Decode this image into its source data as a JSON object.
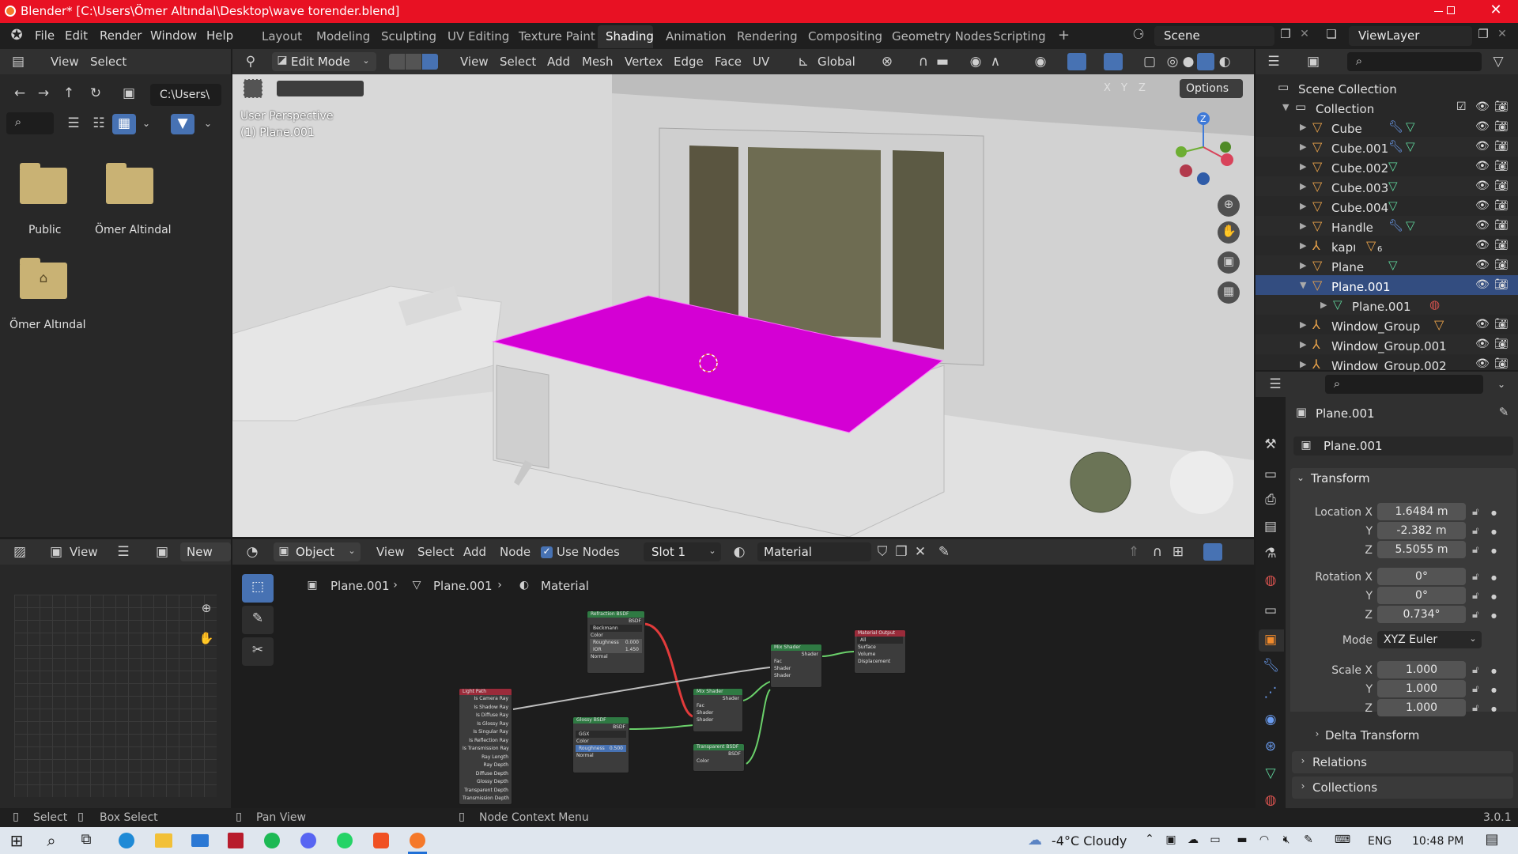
{
  "window": {
    "title": "Blender* [C:\\Users\\Ömer Altındal\\Desktop\\wave torender.blend]"
  },
  "menu": {
    "items": [
      "File",
      "Edit",
      "Render",
      "Window",
      "Help"
    ]
  },
  "workspaces": {
    "tabs": [
      "Layout",
      "Modeling",
      "Sculpting",
      "UV Editing",
      "Texture Paint",
      "Shading",
      "Animation",
      "Rendering",
      "Compositing",
      "Geometry Nodes",
      "Scripting"
    ],
    "active": "Shading",
    "add": "+"
  },
  "scene": {
    "name": "Scene",
    "view_layer": "ViewLayer"
  },
  "file_browser": {
    "menu": [
      "View",
      "Select"
    ],
    "path": "C:\\Users\\",
    "items": [
      {
        "label": "Public",
        "icon": "folder-icon"
      },
      {
        "label": "Ömer Altindal",
        "icon": "folder-icon"
      },
      {
        "label": "Ömer Altındal",
        "icon": "home-folder-icon"
      }
    ]
  },
  "viewport": {
    "mode": "Edit Mode",
    "menu": [
      "View",
      "Select",
      "Add",
      "Mesh",
      "Vertex",
      "Edge",
      "Face",
      "UV"
    ],
    "orientation": "Global",
    "perspective_label": "User Perspective",
    "object_label": "(1) Plane.001",
    "options": "Options",
    "axes": [
      "X",
      "Y",
      "Z"
    ],
    "gizmo_z": "Z",
    "accent_color": "#d400d4"
  },
  "outliner": {
    "root": "Scene Collection",
    "collection": "Collection",
    "items": [
      {
        "name": "Cube",
        "icon": "mesh-object-icon",
        "extra": "wrench-and-mesh"
      },
      {
        "name": "Cube.001",
        "icon": "mesh-object-icon",
        "extra": "wrench-and-mesh"
      },
      {
        "name": "Cube.002",
        "icon": "mesh-object-icon",
        "extra": "mesh"
      },
      {
        "name": "Cube.003",
        "icon": "mesh-object-icon",
        "extra": "mesh"
      },
      {
        "name": "Cube.004",
        "icon": "mesh-object-icon",
        "extra": "mesh"
      },
      {
        "name": "Handle",
        "icon": "mesh-object-icon",
        "extra": "wrench-and-mesh"
      },
      {
        "name": "kapı",
        "icon": "empty-icon",
        "extra": "6"
      },
      {
        "name": "Plane",
        "icon": "mesh-object-icon",
        "extra": "mesh"
      },
      {
        "name": "Plane.001",
        "icon": "mesh-object-icon",
        "extra": "",
        "selected": true
      },
      {
        "name": "Plane.001",
        "icon": "mesh-data-icon",
        "extra": "material",
        "child": true
      },
      {
        "name": "Window_Group",
        "icon": "empty-icon",
        "extra": "object"
      },
      {
        "name": "Window_Group.001",
        "icon": "empty-icon",
        "extra": ""
      },
      {
        "name": "Window_Group.002",
        "icon": "empty-icon",
        "extra": ""
      }
    ]
  },
  "properties": {
    "object_name": "Plane.001",
    "data_name": "Plane.001",
    "panel": "Transform",
    "location": {
      "label": "Location X",
      "x": "1.6484 m",
      "y": "-2.382 m",
      "z": "5.5055 m"
    },
    "rotation": {
      "label": "Rotation X",
      "x": "0°",
      "y": "0°",
      "z": "0.734°"
    },
    "mode": {
      "label": "Mode",
      "value": "XYZ Euler"
    },
    "scale": {
      "label": "Scale X",
      "x": "1.000",
      "y": "1.000",
      "z": "1.000"
    },
    "axis_y": "Y",
    "axis_z": "Z",
    "subpanels": [
      "Delta Transform",
      "Relations",
      "Collections"
    ]
  },
  "image_editor": {
    "view": "View",
    "new": "New"
  },
  "node_editor": {
    "object_type": "Object",
    "menu": [
      "View",
      "Select",
      "Add",
      "Node"
    ],
    "use_nodes": "Use Nodes",
    "slot": "Slot 1",
    "material": "Material",
    "breadcrumb": [
      "Plane.001",
      "Plane.001",
      "Material"
    ],
    "nodes": {
      "refraction": {
        "title": "Refraction BSDF",
        "rows": [
          "BSDF",
          "Beckmann",
          "Color",
          "Roughness",
          "IOR",
          "Normal"
        ],
        "roughness": "0.000",
        "ior": "1.450"
      },
      "lightpath": {
        "title": "Light Path",
        "rows": [
          "Is Camera Ray",
          "Is Shadow Ray",
          "Is Diffuse Ray",
          "Is Glossy Ray",
          "Is Singular Ray",
          "Is Reflection Ray",
          "Is Transmission Ray",
          "Ray Length",
          "Ray Depth",
          "Diffuse Depth",
          "Glossy Depth",
          "Transparent Depth",
          "Transmission Depth"
        ]
      },
      "glossy": {
        "title": "Glossy BSDF",
        "rows": [
          "BSDF",
          "GGX",
          "Color",
          "Roughness",
          "Normal"
        ],
        "roughness": "0.500"
      },
      "mix1": {
        "title": "Mix Shader",
        "rows": [
          "Shader",
          "Fac",
          "Shader",
          "Shader"
        ]
      },
      "transparent": {
        "title": "Transparent BSDF",
        "rows": [
          "BSDF",
          "Color"
        ]
      },
      "mix2": {
        "title": "Mix Shader",
        "rows": [
          "Shader",
          "Fac",
          "Shader",
          "Shader"
        ]
      },
      "output": {
        "title": "Material Output",
        "rows": [
          "All",
          "Surface",
          "Volume",
          "Displacement"
        ]
      }
    }
  },
  "status_bar": {
    "items": [
      "Select",
      "Box Select",
      "Pan View",
      "Node Context Menu"
    ],
    "version": "3.0.1"
  },
  "taskbar": {
    "weather": "-4°C  Cloudy",
    "lang": "ENG",
    "time": "10:48 PM"
  }
}
